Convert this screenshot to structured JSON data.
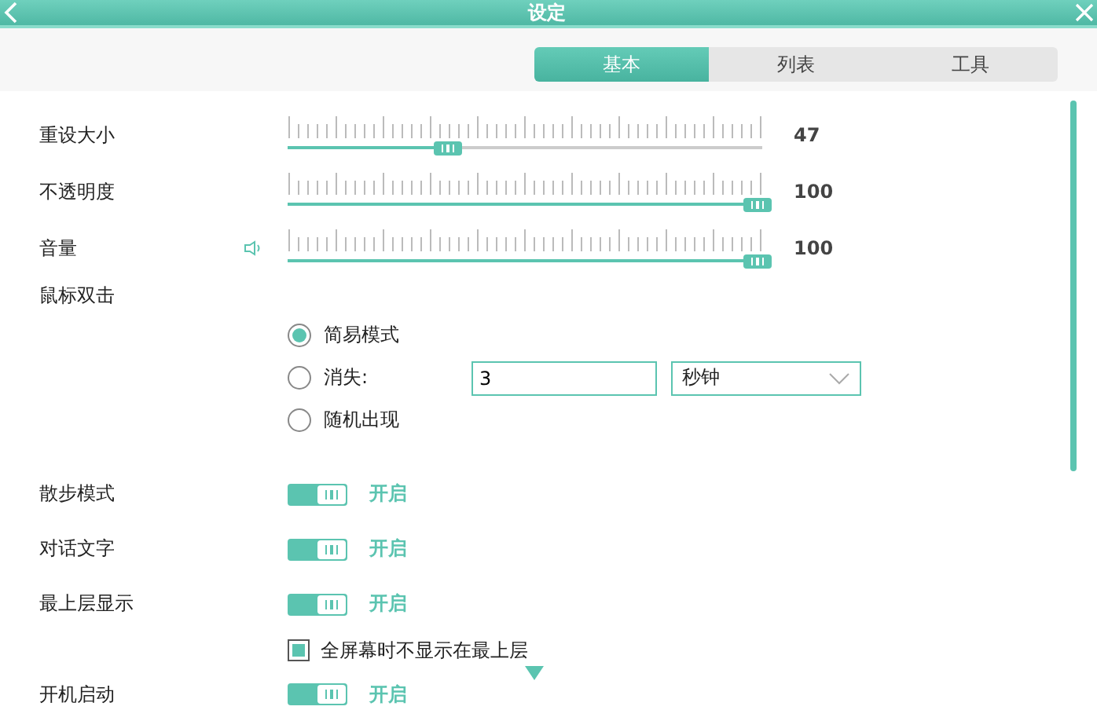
{
  "window": {
    "title": "设定"
  },
  "tabs": [
    {
      "label": "基本",
      "selected": true
    },
    {
      "label": "列表",
      "selected": false
    },
    {
      "label": "工具",
      "selected": false
    }
  ],
  "sliders": [
    {
      "label": "重设大小",
      "level": 0.32,
      "reading": "47",
      "kind": "plain"
    },
    {
      "label": "不透明度",
      "level": 1,
      "reading": "100",
      "kind": "plain"
    },
    {
      "label": "音量",
      "level": 1,
      "reading": "100",
      "kind": "volume"
    }
  ],
  "double_click": {
    "label": "鼠标双击",
    "options": [
      {
        "label": "简易模式",
        "selected": true
      },
      {
        "label": "消失:",
        "selected": false,
        "value": "3",
        "unit": "秒钟"
      },
      {
        "label": "随机出现",
        "selected": false
      }
    ]
  },
  "switches": [
    {
      "label": "散步模式",
      "on": true,
      "status": "开启"
    },
    {
      "label": "对话文字",
      "on": true,
      "status": "开启"
    },
    {
      "label": "最上层显示",
      "on": true,
      "status": "开启",
      "sub_option": {
        "label": "全屏幕时不显示在最上层",
        "checked": true
      }
    },
    {
      "label": "开机启动",
      "on": true,
      "status": "开启"
    }
  ]
}
